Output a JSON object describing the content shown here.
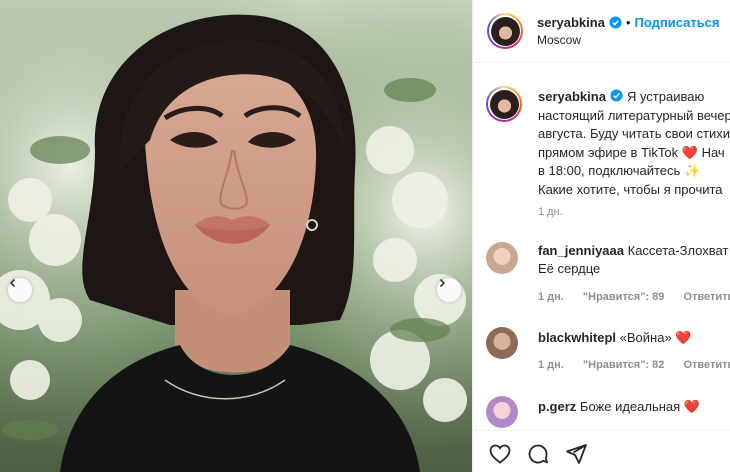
{
  "post": {
    "username": "seryabkina",
    "follow_label": "Подписаться",
    "location": "Moscow",
    "caption_lines": [
      "Я устраиваю",
      "настоящий литературный вечер",
      "августа. Буду читать свои стихи",
      "прямом эфире в TikTok",
      "в 18:00, подключайтесь",
      "Какие хотите, чтобы я прочита"
    ],
    "caption_tail_line4": "Нач",
    "posted_ago": "1 дн."
  },
  "comments": [
    {
      "username": "fan_jenniyaaa",
      "text_line1": "Кассета-Злохват",
      "text_line2": "Её сердце",
      "ago": "1 дн.",
      "likes": "\"Нравится\": 89",
      "reply": "Ответить"
    },
    {
      "username": "blackwhitepl",
      "text_line1": "«Война»",
      "text_line2": "",
      "ago": "1 дн.",
      "likes": "\"Нравится\": 82",
      "reply": "Ответить"
    },
    {
      "username": "p.gerz",
      "text_line1": "Боже идеальная",
      "text_line2": ""
    }
  ],
  "icons": {
    "like": "heart-outline-icon",
    "comment": "speech-bubble-icon",
    "share": "paper-plane-icon",
    "verified": "verified-badge-icon",
    "prev": "chevron-left-icon",
    "next": "chevron-right-icon"
  },
  "colors": {
    "link": "#0095f6",
    "heart": "#ed4956",
    "meta": "#8e8e8e"
  }
}
